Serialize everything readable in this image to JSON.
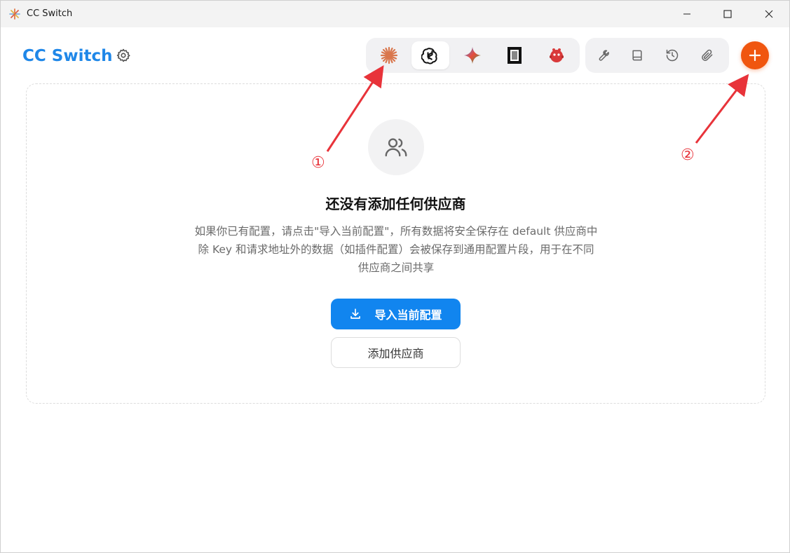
{
  "window": {
    "title": "CC Switch",
    "controls": {
      "minimize": "minimize",
      "maximize": "maximize",
      "close": "close"
    }
  },
  "header": {
    "brand": "CC Switch",
    "brand_color": "#1f87e8",
    "settings_icon": "gear-icon",
    "apps": [
      {
        "icon": "claude-icon",
        "active": false
      },
      {
        "icon": "openai-icon",
        "active": true
      },
      {
        "icon": "gemini-icon",
        "active": false
      },
      {
        "icon": "terminal-app-icon",
        "active": false
      },
      {
        "icon": "red-mascot-icon",
        "active": false
      }
    ],
    "tools": [
      {
        "icon": "wrench-icon"
      },
      {
        "icon": "book-icon"
      },
      {
        "icon": "history-icon"
      },
      {
        "icon": "paperclip-icon"
      }
    ],
    "add_button_icon": "plus-icon",
    "add_button_color": "#f0560f"
  },
  "empty_state": {
    "icon": "users-icon",
    "title": "还没有添加任何供应商",
    "description_line1": "如果你已有配置，请点击\"导入当前配置\"，所有数据将安全保存在 default 供应商中",
    "description_line2": "除 Key 和请求地址外的数据（如插件配置）会被保存到通用配置片段，用于在不同",
    "description_line3": "供应商之间共享",
    "import_button": "导入当前配置",
    "add_provider_button": "添加供应商",
    "primary_color": "#1185ef"
  },
  "annotations": {
    "label1": "①",
    "label2": "②",
    "color": "#e8333a"
  }
}
